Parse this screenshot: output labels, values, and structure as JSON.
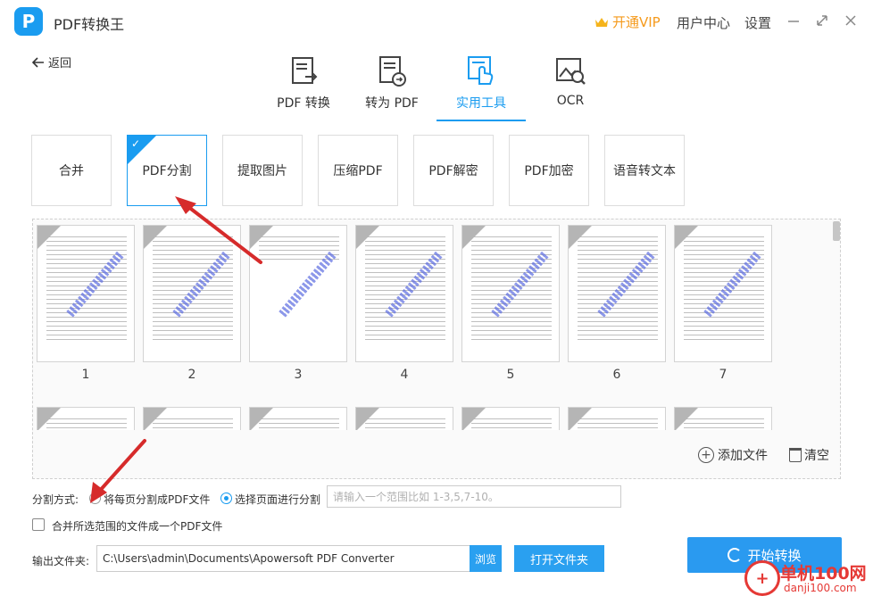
{
  "app": {
    "logo_letter": "P",
    "title": "PDF转换王"
  },
  "header": {
    "vip": "开通VIP",
    "user_center": "用户中心",
    "settings": "设置"
  },
  "back": {
    "label": "返回"
  },
  "tabs": [
    {
      "label": "PDF 转换",
      "icon": "pdf-convert-icon"
    },
    {
      "label": "转为 PDF",
      "icon": "to-pdf-icon"
    },
    {
      "label": "实用工具",
      "icon": "tools-icon",
      "active": true
    },
    {
      "label": "OCR",
      "icon": "ocr-icon"
    }
  ],
  "tools": [
    {
      "label": "合并"
    },
    {
      "label": "PDF分割",
      "active": true
    },
    {
      "label": "提取图片"
    },
    {
      "label": "压缩PDF"
    },
    {
      "label": "PDF解密"
    },
    {
      "label": "PDF加密"
    },
    {
      "label": "语音转文本"
    }
  ],
  "pages": [
    "1",
    "2",
    "3",
    "4",
    "5",
    "6",
    "7"
  ],
  "files_actions": {
    "add": "添加文件",
    "clear": "清空"
  },
  "split": {
    "label": "分割方式:",
    "option_each": "将每页分割成PDF文件",
    "option_select": "选择页面进行分割",
    "selected": "option_select",
    "range_placeholder": "请输入一个范围比如 1-3,5,7-10。"
  },
  "merge": {
    "label": "合并所选范围的文件成一个PDF文件",
    "checked": false
  },
  "output": {
    "label": "输出文件夹:",
    "path": "C:\\Users\\admin\\Documents\\Apowersoft PDF Converter",
    "browse": "浏览",
    "open_folder": "打开文件夹"
  },
  "start": {
    "label": "开始转换"
  },
  "watermark": {
    "main": "单机100网",
    "sub": "danji100.com"
  },
  "colors": {
    "accent": "#1a9cf0",
    "vip": "#f59a1c",
    "arrow": "#d62b2b"
  }
}
